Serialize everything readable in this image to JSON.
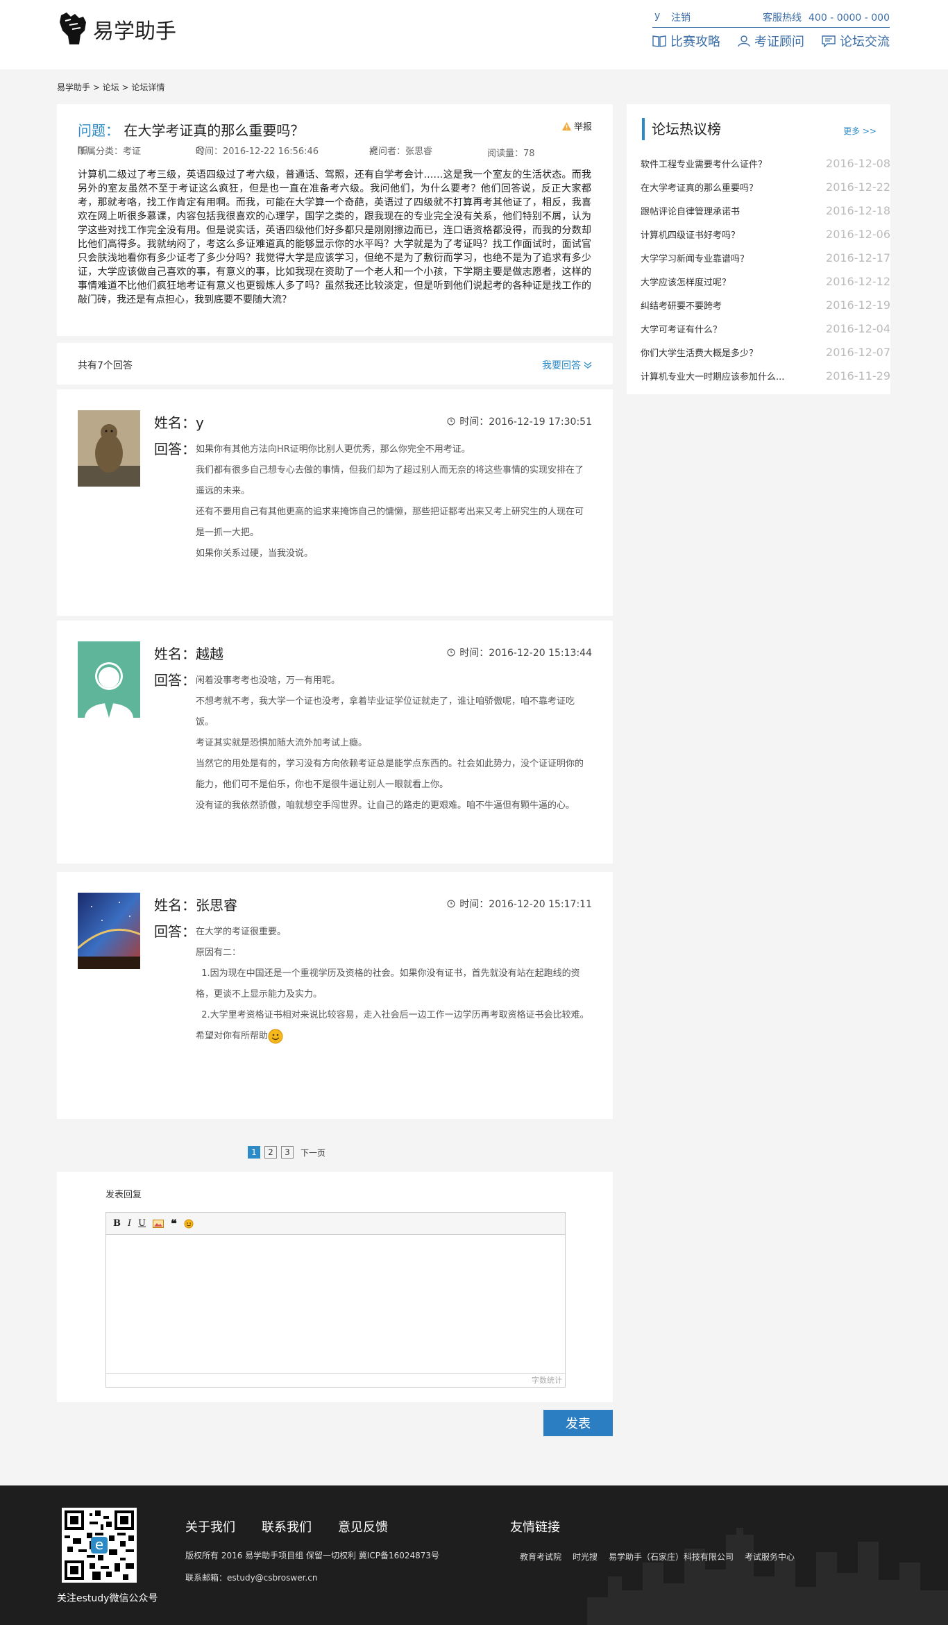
{
  "brand": {
    "name": "易学助手"
  },
  "topbar": {
    "user": "y",
    "logout": "注销",
    "hotline_label": "客服热线",
    "hotline": "400 - 0000 - 000"
  },
  "nav": [
    "比赛攻略",
    "考证顾问",
    "论坛交流"
  ],
  "breadcrumb": "易学助手 > 论坛 > 论坛详情",
  "question": {
    "label": "问题：",
    "title": "在大学考证真的那么重要吗？",
    "report": "举报",
    "category": "所属分类：考证",
    "time": "时间：2016-12-22 16:56:46",
    "asker": "提问者：张思睿",
    "views": "阅读量：78",
    "body": "计算机二级过了考三级，英语四级过了考六级，普通话、驾照，还有自学考会计……这是我一个室友的生活状态。而我另外的室友虽然不至于考证这么疯狂，但是也一直在准备考六级。我问他们，为什么要考？他们回答说，反正大家都考，那就考咯，找工作肯定有用啊。而我，可能在大学算一个奇葩，英语过了四级就不打算再考其他证了，相反，我喜欢在网上听很多慕课，内容包括我很喜欢的心理学，国学之类的，跟我现在的专业完全没有关系，他们特别不屑，认为学这些对找工作完全没有用。但是说实话，英语四级他们好多都只是刚刚擦边而已，连口语资格都没得，而我的分数却比他们高得多。我就纳闷了，考这么多证难道真的能够显示你的水平吗？大学就是为了考证吗？找工作面试时，面试官只会肤浅地看你有多少证考了多少分吗？我觉得大学是应该学习，但绝不是为了敷衍而学习，也绝不是为了追求有多少证，大学应该做自己喜欢的事，有意义的事，比如我现在资助了一个老人和一个小孩，下学期主要是做志愿者，这样的事情难道不比他们疯狂地考证有意义也更锻炼人多了吗？虽然我还比较淡定，但是听到他们说起考的各种证是找工作的敲门砖，我还是有点担心，我到底要不要随大流？"
  },
  "answers_bar": {
    "count": "共有7个回答",
    "reply": "我要回答"
  },
  "answers": [
    {
      "name_label": "姓名：",
      "name": "y",
      "time": "时间：2016-12-19 17:30:51",
      "answer_label": "回答：",
      "lines": [
        "如果你有其他方法向HR证明你比别人更优秀，那么你完全不用考证。",
        "我们都有很多自己想专心去做的事情，但我们却为了超过别人而无奈的将这些事情的实现安排在了遥远的未来。",
        "还有不要用自己有其他更高的追求来掩饰自己的慵懒，那些把证都考出来又考上研究生的人现在可是一抓一大把。",
        "如果你关系过硬，当我没说。"
      ]
    },
    {
      "name_label": "姓名：",
      "name": "越越",
      "time": "时间：2016-12-20 15:13:44",
      "answer_label": "回答：",
      "lines": [
        "闲着没事考考也没啥，万一有用呢。",
        "不想考就不考，我大学一个证也没考，拿着毕业证学位证就走了，谁让咱骄傲呢，咱不靠考证吃饭。",
        "考证其实就是恐惧加随大流外加考试上瘾。",
        "当然它的用处是有的，学习没有方向依赖考证总是能学点东西的。社会如此势力，没个证证明你的能力，他们可不是伯乐，你也不是很牛逼让别人一眼就看上你。",
        "没有证的我依然骄傲，咱就想空手闯世界。让自己的路走的更艰难。咱不牛逼但有颗牛逼的心。"
      ]
    },
    {
      "name_label": "姓名：",
      "name": "张思睿",
      "time": "时间：2016-12-20 15:17:11",
      "answer_label": "回答：",
      "lines": [
        "在大学的考证很重要。",
        "原因有二：",
        "  1.因为现在中国还是一个重视学历及资格的社会。如果你没有证书，首先就没有站在起跑线的资格，更谈不上显示能力及实力。",
        "  2.大学里考资格证书相对来说比较容易，走入社会后一边工作一边学历再考取资格证书会比较难。",
        "希望对你有所帮助"
      ]
    }
  ],
  "pager": {
    "pages": [
      "1",
      "2",
      "3"
    ],
    "next": "下一页"
  },
  "editor": {
    "title": "发表回复",
    "counter": "字数统计",
    "submit": "发表"
  },
  "sidebar": {
    "title": "论坛热议榜",
    "more": "更多 >>",
    "items": [
      {
        "title": "软件工程专业需要考什么证件？",
        "date": "2016-12-08"
      },
      {
        "title": "在大学考证真的那么重要吗？",
        "date": "2016-12-22"
      },
      {
        "title": "跟帖评论自律管理承诺书",
        "date": "2016-12-18"
      },
      {
        "title": "计算机四级证书好考吗？",
        "date": "2016-12-06"
      },
      {
        "title": "大学学习新闻专业靠谱吗？",
        "date": "2016-12-17"
      },
      {
        "title": "大学应该怎样度过呢？",
        "date": "2016-12-12"
      },
      {
        "title": "纠结考研要不要跨考",
        "date": "2016-12-19"
      },
      {
        "title": "大学可考证有什么？",
        "date": "2016-12-04"
      },
      {
        "title": "你们大学生活费大概是多少？",
        "date": "2016-12-07"
      },
      {
        "title": "计算机专业大一时期应该参加什么...",
        "date": "2016-11-29"
      }
    ]
  },
  "footer": {
    "qr_caption": "关注estudy微信公众号",
    "links": [
      "关于我们",
      "联系我们",
      "意见反馈"
    ],
    "copyright": "版权所有 2016 易学助手项目组 保留一切权利 冀ICP备16024873号",
    "email": "联系邮箱：estudy@csbroswer.cn",
    "friends_title": "友情链接",
    "friends": [
      "教育考试院",
      "时光搜",
      "易学助手（石家庄）科技有限公司",
      "考试服务中心"
    ]
  },
  "colors": {
    "accent": "#2c8bc7",
    "nav": "#3c6fa8",
    "footer_bg": "#1e1e1e"
  }
}
